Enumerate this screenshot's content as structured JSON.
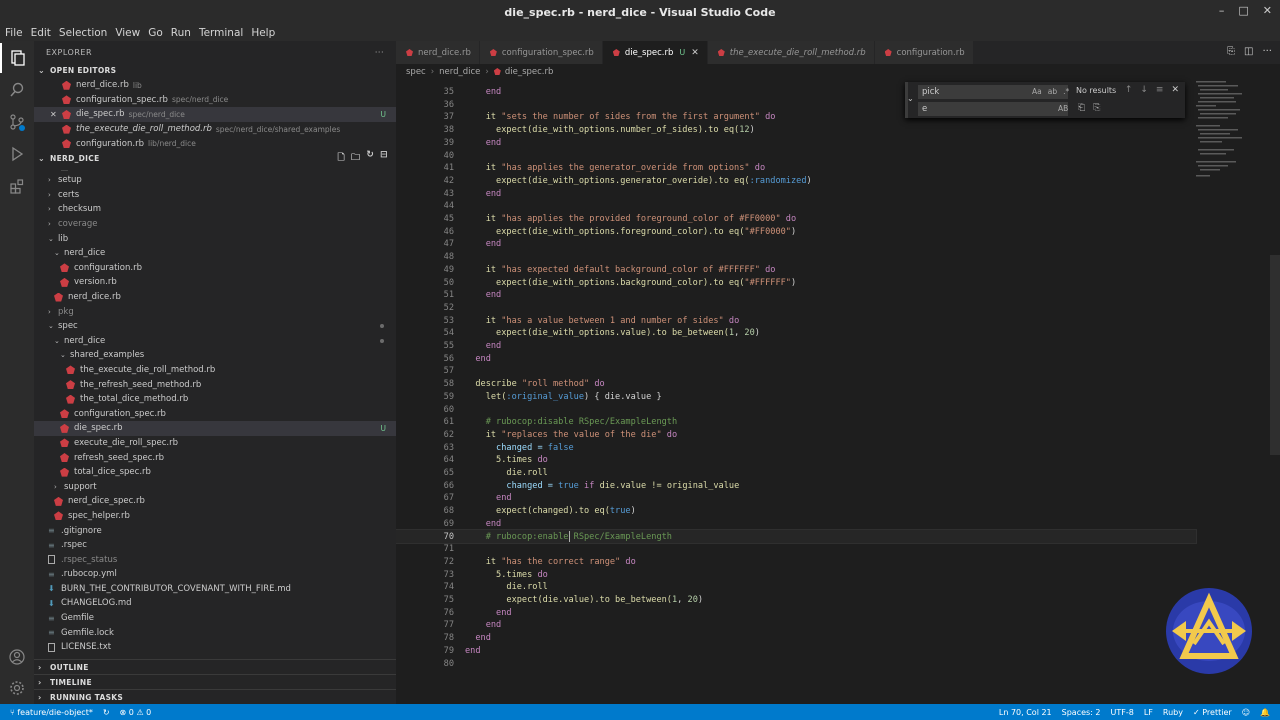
{
  "window": {
    "title": "die_spec.rb - nerd_dice - Visual Studio Code"
  },
  "menu": [
    "File",
    "Edit",
    "Selection",
    "View",
    "Go",
    "Run",
    "Terminal",
    "Help"
  ],
  "sidebar": {
    "header": "EXPLORER",
    "open_editors": {
      "title": "OPEN EDITORS",
      "items": [
        {
          "name": "nerd_dice.rb",
          "desc": "lib",
          "badge": ""
        },
        {
          "name": "configuration_spec.rb",
          "desc": "spec/nerd_dice",
          "badge": ""
        },
        {
          "name": "die_spec.rb",
          "desc": "spec/nerd_dice",
          "badge": "U"
        },
        {
          "name": "the_execute_die_roll_method.rb",
          "desc": "spec/nerd_dice/shared_examples",
          "badge": ""
        },
        {
          "name": "configuration.rb",
          "desc": "lib/nerd_dice",
          "badge": ""
        }
      ]
    },
    "project": {
      "title": "NERD_DICE",
      "items": [
        {
          "name": "setup",
          "kind": "folder-closed"
        },
        {
          "name": "certs",
          "kind": "folder-closed"
        },
        {
          "name": "checksum",
          "kind": "folder-closed"
        },
        {
          "name": "coverage",
          "kind": "folder-closed"
        },
        {
          "name": "lib",
          "kind": "folder-open"
        },
        {
          "name": "nerd_dice",
          "kind": "folder-open"
        },
        {
          "name": "configuration.rb",
          "kind": "rb"
        },
        {
          "name": "version.rb",
          "kind": "rb"
        },
        {
          "name": "nerd_dice.rb",
          "kind": "rb"
        },
        {
          "name": "pkg",
          "kind": "folder-closed"
        },
        {
          "name": "spec",
          "kind": "folder-open"
        },
        {
          "name": "nerd_dice",
          "kind": "folder-open"
        },
        {
          "name": "shared_examples",
          "kind": "folder-open"
        },
        {
          "name": "the_execute_die_roll_method.rb",
          "kind": "rb"
        },
        {
          "name": "the_refresh_seed_method.rb",
          "kind": "rb"
        },
        {
          "name": "the_total_dice_method.rb",
          "kind": "rb"
        },
        {
          "name": "configuration_spec.rb",
          "kind": "rb"
        },
        {
          "name": "die_spec.rb",
          "kind": "rb",
          "badge": "U"
        },
        {
          "name": "execute_die_roll_spec.rb",
          "kind": "rb"
        },
        {
          "name": "refresh_seed_spec.rb",
          "kind": "rb"
        },
        {
          "name": "total_dice_spec.rb",
          "kind": "rb"
        },
        {
          "name": "support",
          "kind": "folder-closed"
        },
        {
          "name": "nerd_dice_spec.rb",
          "kind": "rb"
        },
        {
          "name": "spec_helper.rb",
          "kind": "rb"
        },
        {
          "name": ".gitignore",
          "kind": "dot"
        },
        {
          "name": ".rspec",
          "kind": "dot"
        },
        {
          "name": ".rspec_status",
          "kind": "txt"
        },
        {
          "name": ".rubocop.yml",
          "kind": "dot"
        },
        {
          "name": "BURN_THE_CONTRIBUTOR_COVENANT_WITH_FIRE.md",
          "kind": "md"
        },
        {
          "name": "CHANGELOG.md",
          "kind": "md"
        },
        {
          "name": "Gemfile",
          "kind": "dot"
        },
        {
          "name": "Gemfile.lock",
          "kind": "dot"
        },
        {
          "name": "LICENSE.txt",
          "kind": "txt"
        }
      ]
    },
    "bottom_sections": [
      "OUTLINE",
      "TIMELINE",
      "RUNNING TASKS"
    ]
  },
  "tabs": [
    {
      "label": "nerd_dice.rb",
      "mod": "",
      "italic": false
    },
    {
      "label": "configuration_spec.rb",
      "mod": "",
      "italic": false
    },
    {
      "label": "die_spec.rb",
      "mod": "U",
      "italic": false
    },
    {
      "label": "the_execute_die_roll_method.rb",
      "mod": "",
      "italic": true
    },
    {
      "label": "configuration.rb",
      "mod": "",
      "italic": false
    }
  ],
  "breadcrumb": [
    "spec",
    "nerd_dice",
    "die_spec.rb"
  ],
  "find": {
    "query": "pick",
    "replace": "e",
    "result": "No results",
    "opt_case": "Aa",
    "opt_word": "ab",
    "opt_regex": ".*",
    "opt_preserve": "AB"
  },
  "code": [
    {
      "n": "",
      "indent": "      ",
      "tokens": []
    },
    {
      "n": "35",
      "indent": "    ",
      "tokens": [
        [
          "end",
          "t-kw"
        ]
      ]
    },
    {
      "n": "36",
      "indent": "",
      "tokens": []
    },
    {
      "n": "37",
      "indent": "    ",
      "tokens": [
        [
          "it ",
          "t-fn"
        ],
        [
          "\"sets the number of sides from the first argument\"",
          "t-str"
        ],
        [
          " do",
          "t-kw"
        ]
      ]
    },
    {
      "n": "38",
      "indent": "      ",
      "tokens": [
        [
          "expect(die_with_options.number_of_sides).to eq(",
          "t-fn"
        ],
        [
          "12",
          "t-num"
        ],
        [
          ")",
          ""
        ]
      ]
    },
    {
      "n": "39",
      "indent": "    ",
      "tokens": [
        [
          "end",
          "t-kw"
        ]
      ]
    },
    {
      "n": "40",
      "indent": "",
      "tokens": []
    },
    {
      "n": "41",
      "indent": "    ",
      "tokens": [
        [
          "it ",
          "t-fn"
        ],
        [
          "\"has applies the generator_overide from options\"",
          "t-str"
        ],
        [
          " do",
          "t-kw"
        ]
      ]
    },
    {
      "n": "42",
      "indent": "      ",
      "tokens": [
        [
          "expect(die_with_options.generator_overide).to eq(",
          "t-fn"
        ],
        [
          ":randomized",
          "t-sym"
        ],
        [
          ")",
          ""
        ]
      ]
    },
    {
      "n": "43",
      "indent": "    ",
      "tokens": [
        [
          "end",
          "t-kw"
        ]
      ]
    },
    {
      "n": "44",
      "indent": "",
      "tokens": []
    },
    {
      "n": "45",
      "indent": "    ",
      "tokens": [
        [
          "it ",
          "t-fn"
        ],
        [
          "\"has applies the provided foreground_color of #FF0000\"",
          "t-str"
        ],
        [
          " do",
          "t-kw"
        ]
      ]
    },
    {
      "n": "46",
      "indent": "      ",
      "tokens": [
        [
          "expect(die_with_options.foreground_color).to eq(",
          "t-fn"
        ],
        [
          "\"#FF0000\"",
          "t-str"
        ],
        [
          ")",
          ""
        ]
      ]
    },
    {
      "n": "47",
      "indent": "    ",
      "tokens": [
        [
          "end",
          "t-kw"
        ]
      ]
    },
    {
      "n": "48",
      "indent": "",
      "tokens": []
    },
    {
      "n": "49",
      "indent": "    ",
      "tokens": [
        [
          "it ",
          "t-fn"
        ],
        [
          "\"has expected default background_color of #FFFFFF\"",
          "t-str"
        ],
        [
          " do",
          "t-kw"
        ]
      ]
    },
    {
      "n": "50",
      "indent": "      ",
      "tokens": [
        [
          "expect(die_with_options.background_color).to eq(",
          "t-fn"
        ],
        [
          "\"#FFFFFF\"",
          "t-str"
        ],
        [
          ")",
          ""
        ]
      ]
    },
    {
      "n": "51",
      "indent": "    ",
      "tokens": [
        [
          "end",
          "t-kw"
        ]
      ]
    },
    {
      "n": "52",
      "indent": "",
      "tokens": []
    },
    {
      "n": "53",
      "indent": "    ",
      "tokens": [
        [
          "it ",
          "t-fn"
        ],
        [
          "\"has a value between 1 and number of sides\"",
          "t-str"
        ],
        [
          " do",
          "t-kw"
        ]
      ]
    },
    {
      "n": "54",
      "indent": "      ",
      "tokens": [
        [
          "expect(die_with_options.value).to be_between(",
          "t-fn"
        ],
        [
          "1",
          "t-num"
        ],
        [
          ", ",
          ""
        ],
        [
          "20",
          "t-num"
        ],
        [
          ")",
          ""
        ]
      ]
    },
    {
      "n": "55",
      "indent": "    ",
      "tokens": [
        [
          "end",
          "t-kw"
        ]
      ]
    },
    {
      "n": "56",
      "indent": "  ",
      "tokens": [
        [
          "end",
          "t-kw"
        ]
      ]
    },
    {
      "n": "57",
      "indent": "",
      "tokens": []
    },
    {
      "n": "58",
      "indent": "  ",
      "tokens": [
        [
          "describe ",
          "t-fn"
        ],
        [
          "\"roll method\"",
          "t-str"
        ],
        [
          " do",
          "t-kw"
        ]
      ]
    },
    {
      "n": "59",
      "indent": "    ",
      "tokens": [
        [
          "let(",
          "t-fn"
        ],
        [
          ":original_value",
          "t-sym"
        ],
        [
          ") { die.value }",
          ""
        ]
      ]
    },
    {
      "n": "60",
      "indent": "",
      "tokens": []
    },
    {
      "n": "61",
      "indent": "    ",
      "tokens": [
        [
          "# rubocop:disable RSpec/ExampleLength",
          "t-cm"
        ]
      ]
    },
    {
      "n": "62",
      "indent": "    ",
      "tokens": [
        [
          "it ",
          "t-fn"
        ],
        [
          "\"replaces the value of the die\"",
          "t-str"
        ],
        [
          " do",
          "t-kw"
        ]
      ]
    },
    {
      "n": "63",
      "indent": "      ",
      "tokens": [
        [
          "changed = ",
          "t-var"
        ],
        [
          "false",
          "t-sym"
        ]
      ]
    },
    {
      "n": "64",
      "indent": "      ",
      "tokens": [
        [
          "5.times ",
          "t-fn"
        ],
        [
          "do",
          "t-kw"
        ]
      ]
    },
    {
      "n": "65",
      "indent": "        ",
      "tokens": [
        [
          "die.roll",
          "t-fn"
        ]
      ]
    },
    {
      "n": "66",
      "indent": "        ",
      "tokens": [
        [
          "changed = ",
          "t-var"
        ],
        [
          "true",
          "t-sym"
        ],
        [
          " if ",
          "t-kw"
        ],
        [
          "die.value != original_value",
          "t-fn"
        ]
      ]
    },
    {
      "n": "67",
      "indent": "      ",
      "tokens": [
        [
          "end",
          "t-kw"
        ]
      ]
    },
    {
      "n": "68",
      "indent": "      ",
      "tokens": [
        [
          "expect(changed).to eq(",
          "t-fn"
        ],
        [
          "true",
          "t-sym"
        ],
        [
          ")",
          ""
        ]
      ]
    },
    {
      "n": "69",
      "indent": "    ",
      "tokens": [
        [
          "end",
          "t-kw"
        ]
      ]
    },
    {
      "n": "70",
      "indent": "    ",
      "tokens": [
        [
          "# rubocop:enable RSpec/ExampleLength",
          "t-cm"
        ]
      ],
      "current": true
    },
    {
      "n": "71",
      "indent": "",
      "tokens": []
    },
    {
      "n": "72",
      "indent": "    ",
      "tokens": [
        [
          "it ",
          "t-fn"
        ],
        [
          "\"has the correct range\"",
          "t-str"
        ],
        [
          " do",
          "t-kw"
        ]
      ]
    },
    {
      "n": "73",
      "indent": "      ",
      "tokens": [
        [
          "5.times ",
          "t-fn"
        ],
        [
          "do",
          "t-kw"
        ]
      ]
    },
    {
      "n": "74",
      "indent": "        ",
      "tokens": [
        [
          "die.roll",
          "t-fn"
        ]
      ]
    },
    {
      "n": "75",
      "indent": "        ",
      "tokens": [
        [
          "expect(die.value).to be_between(",
          "t-fn"
        ],
        [
          "1",
          "t-num"
        ],
        [
          ", ",
          ""
        ],
        [
          "20",
          "t-num"
        ],
        [
          ")",
          ""
        ]
      ]
    },
    {
      "n": "76",
      "indent": "      ",
      "tokens": [
        [
          "end",
          "t-kw"
        ]
      ]
    },
    {
      "n": "77",
      "indent": "    ",
      "tokens": [
        [
          "end",
          "t-kw"
        ]
      ]
    },
    {
      "n": "78",
      "indent": "  ",
      "tokens": [
        [
          "end",
          "t-kw"
        ]
      ]
    },
    {
      "n": "79",
      "indent": "",
      "tokens": [
        [
          "end",
          "t-kw"
        ]
      ]
    },
    {
      "n": "80",
      "indent": "",
      "tokens": []
    }
  ],
  "status": {
    "branch": "feature/die-object*",
    "errors": "0",
    "warnings": "0",
    "position": "Ln 70, Col 21",
    "spaces": "Spaces: 2",
    "encoding": "UTF-8",
    "eol": "LF",
    "language": "Ruby",
    "formatter": "Prettier"
  },
  "colors": {
    "accent": "#007acc",
    "ruby": "#cc3e44",
    "string": "#ce9178",
    "keyword": "#c586c0",
    "comment": "#6a9955"
  }
}
